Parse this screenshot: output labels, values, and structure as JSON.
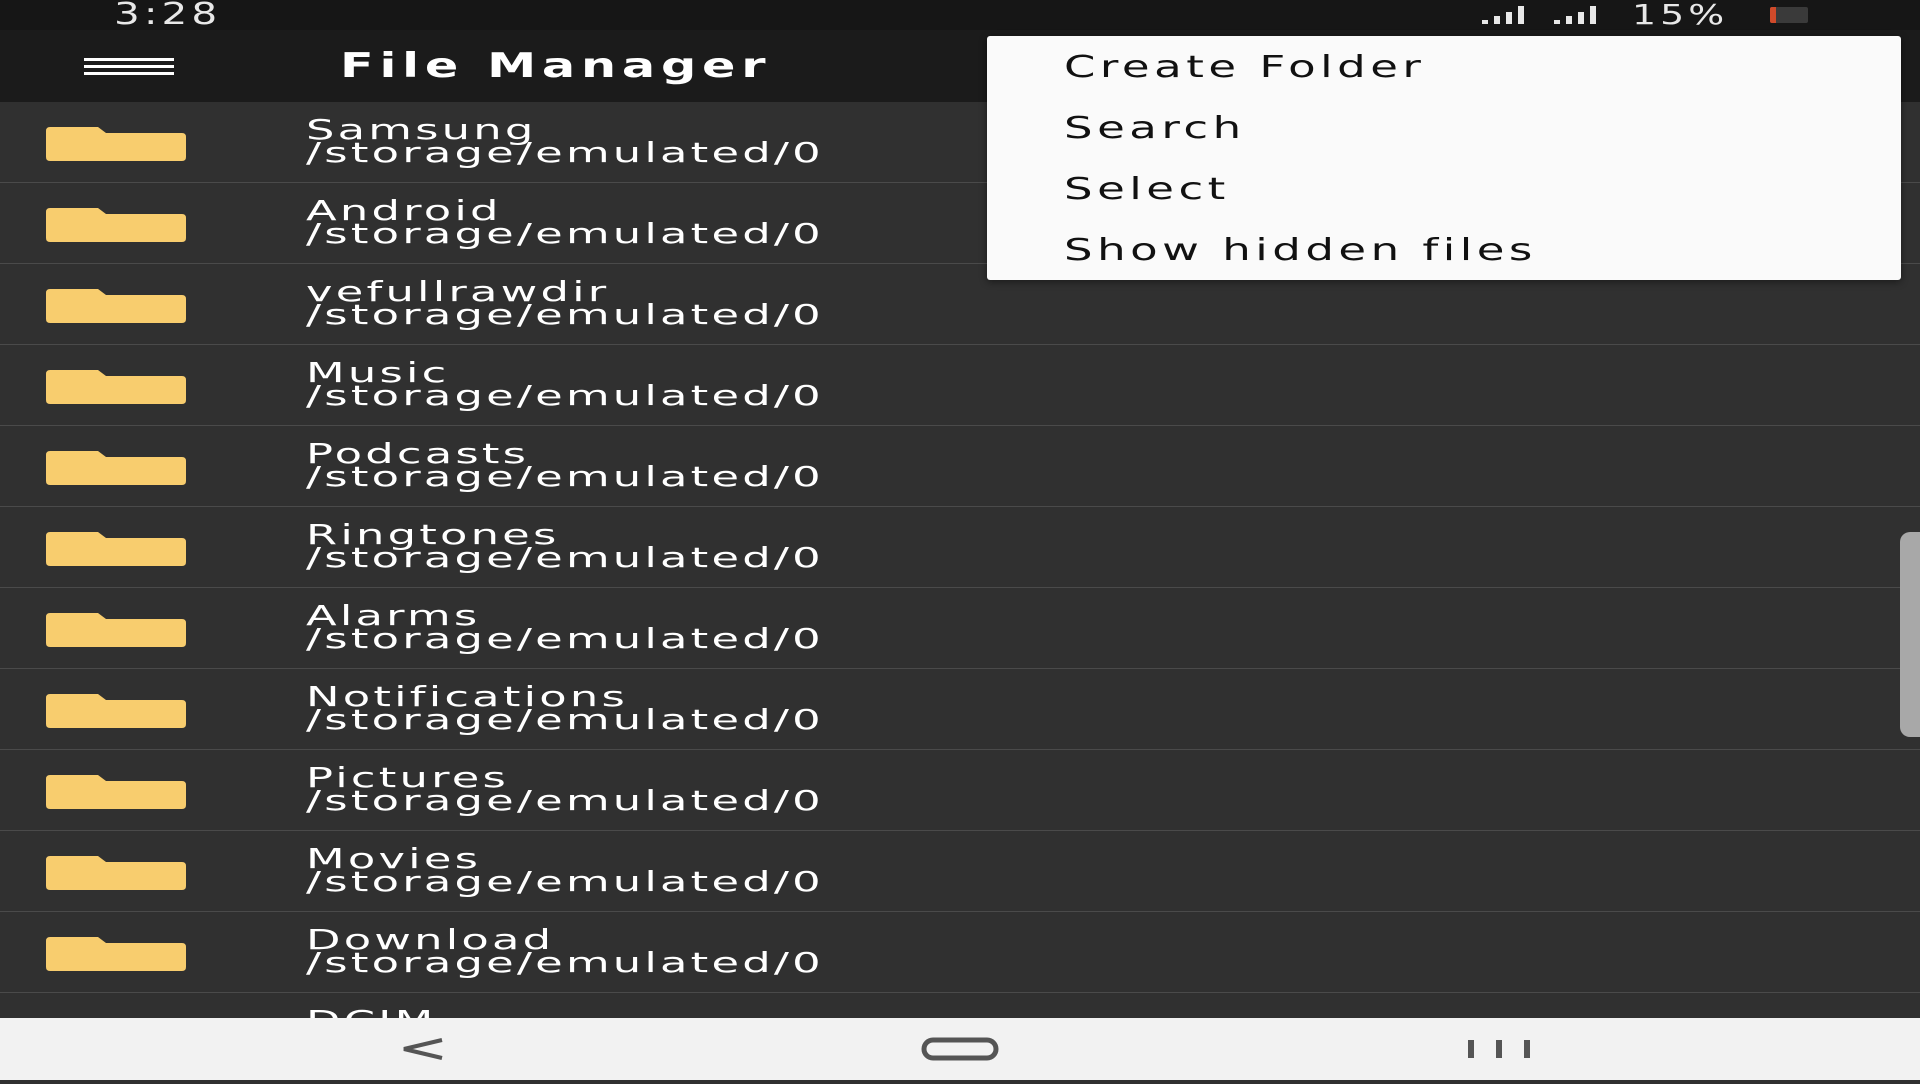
{
  "status_bar": {
    "time": "3:28",
    "battery_percent": "15%",
    "battery_level": 0.15,
    "signal_icons": [
      "signal-bars-icon",
      "signal-bars-icon"
    ]
  },
  "app_bar": {
    "title": "File Manager",
    "menu_icon": "hamburger-menu-icon"
  },
  "popup_menu": {
    "items": [
      "Create Folder",
      "Search",
      "Select",
      "Show hidden files"
    ]
  },
  "folders": [
    {
      "name": "Samsung",
      "path": "/storage/emulated/0"
    },
    {
      "name": "Android",
      "path": "/storage/emulated/0"
    },
    {
      "name": "vefullrawdir",
      "path": "/storage/emulated/0"
    },
    {
      "name": "Music",
      "path": "/storage/emulated/0"
    },
    {
      "name": "Podcasts",
      "path": "/storage/emulated/0"
    },
    {
      "name": "Ringtones",
      "path": "/storage/emulated/0"
    },
    {
      "name": "Alarms",
      "path": "/storage/emulated/0"
    },
    {
      "name": "Notifications",
      "path": "/storage/emulated/0"
    },
    {
      "name": "Pictures",
      "path": "/storage/emulated/0"
    },
    {
      "name": "Movies",
      "path": "/storage/emulated/0"
    },
    {
      "name": "Download",
      "path": "/storage/emulated/0"
    },
    {
      "name": "DCIM",
      "path": ""
    }
  ],
  "colors": {
    "folder": "#f8cd6e",
    "background": "#303030",
    "app_bar": "#1b1b1b",
    "menu_background": "#fafafa",
    "battery_low": "#d04a2a"
  },
  "nav_bar": {
    "back_icon": "back-chevron-icon",
    "home_icon": "home-pill-icon",
    "recents_icon": "recents-bars-icon"
  }
}
